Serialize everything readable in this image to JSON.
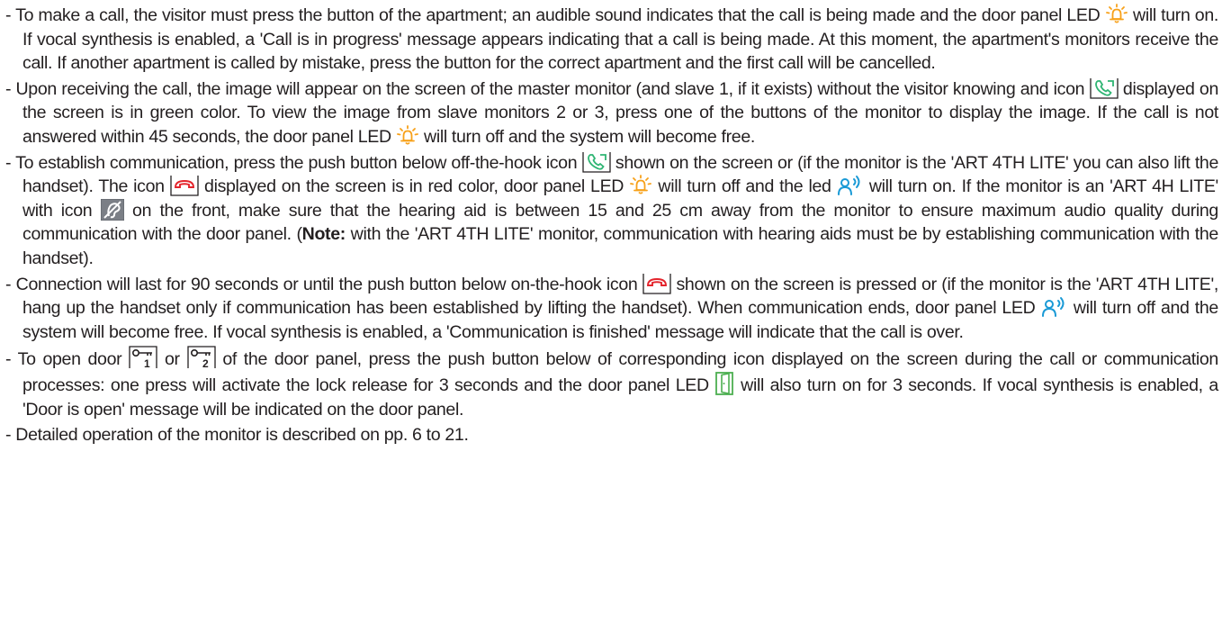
{
  "paragraphs": [
    {
      "parts": [
        "- To make a call, the visitor must press the button of the apartment; an audible sound indicates that the call is being made and the door panel LED",
        "will turn on. If vocal synthesis is enabled, a 'Call is in progress' message appears indicating that a call is being made. At this moment, the apartment's monitors receive the call. If another apartment is called by mistake, press the button for the correct apartment and the first call will be cancelled."
      ]
    },
    {
      "parts": [
        "- Upon receiving the call, the image will appear on the screen of the master monitor (and slave 1, if it exists) without the visitor knowing and icon",
        "displayed on the screen is in green color. To view the image from slave monitors 2 or 3, press one of the buttons of the monitor to display the image. If the call is not answered within 45 seconds, the door panel LED",
        "will turn off and the system will become free."
      ]
    },
    {
      "parts": [
        "- To establish communication, press the push button below off-the-hook icon",
        "shown on the screen or (if the monitor is the 'ART 4TH LITE' you can also lift the handset). The icon",
        "displayed on the screen is in red color, door panel LED",
        "will turn off and the led",
        "will turn on. If the monitor is an 'ART 4H LITE' with icon",
        "on the front, make sure that the hearing aid is between 15 and 25 cm away from the monitor to ensure maximum audio quality during communication with the door panel. (",
        "Note:",
        "with the 'ART 4TH LITE' monitor, communication with hearing aids must be by establishing communication with the handset)."
      ]
    },
    {
      "parts": [
        "- Connection will last for 90 seconds or until the push button below on-the-hook icon",
        "shown on the screen is pressed or (if the monitor is the 'ART 4TH LITE', hang up the handset only if communication has been established by lifting the handset). When communication ends, door panel LED",
        "will turn off and the system will become free. If vocal synthesis is enabled, a 'Communication is finished' message will indicate that the call is over."
      ]
    },
    {
      "parts": [
        "- To open door",
        "or",
        "of the door panel, press the push button below of corresponding icon displayed on the screen during the call or communication processes: one press will activate the lock release for 3 seconds and the door panel LED",
        "will also turn on for 3 seconds. If vocal synthesis is enabled, a 'Door is open' message will be indicated on the door panel."
      ]
    },
    {
      "parts": [
        "- Detailed operation of the monitor is described on pp. 6 to 21."
      ]
    }
  ],
  "icons": {
    "bell": "bell-led-icon",
    "phone_green": "phone-off-hook-icon",
    "phone_red": "phone-on-hook-icon",
    "speak": "speak-led-icon",
    "hearing": "hearing-aid-icon",
    "key1": "door-1-key-icon",
    "key2": "door-2-key-icon",
    "door": "door-open-led-icon"
  },
  "key_labels": {
    "door1": "1",
    "door2": "2"
  },
  "colors": {
    "text": "#231f20",
    "bell_orange": "#f7a11a",
    "phone_green": "#2fb573",
    "phone_red": "#e4242c",
    "speak_blue": "#1a9ad6",
    "door_green": "#4caf50"
  }
}
